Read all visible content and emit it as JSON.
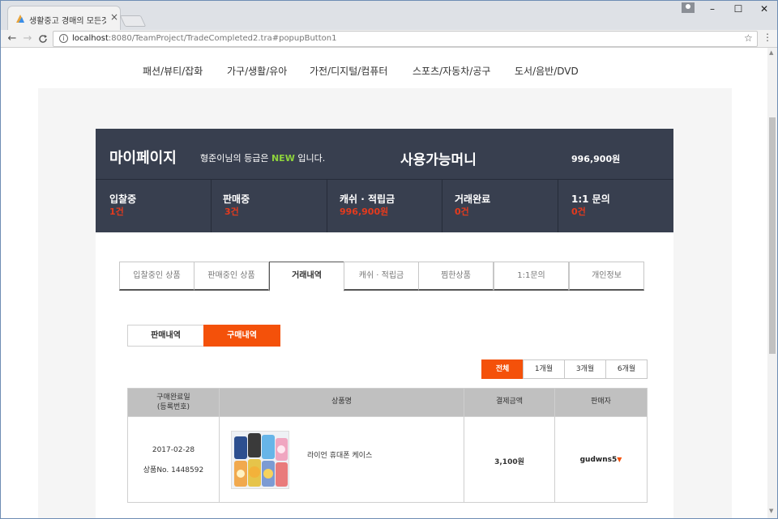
{
  "browser": {
    "tab_title": "생활중고 경매의 모든것",
    "tab_close": "×",
    "url_host": "localhost",
    "url_rest": ":8080/TeamProject/TradeCompleted2.tra#popupButton1",
    "window_controls": [
      "–",
      "☐",
      "✕"
    ],
    "nav_icons": {
      "back": "←",
      "forward": "→",
      "reload": "C"
    }
  },
  "categories": [
    "패션/뷰티/잡화",
    "가구/생활/유아",
    "가전/디지털/컴퓨터",
    "스포츠/자동차/공구",
    "도서/음반/DVD"
  ],
  "mypage": {
    "title": "마이페이지",
    "grade_prefix": "형준이님의 등급은",
    "grade_badge": "NEW",
    "grade_suffix": "입니다.",
    "money_label": "사용가능머니",
    "money_value": "996,900원",
    "stats": [
      {
        "label": "입찰중",
        "value": "1건"
      },
      {
        "label": "판매중",
        "value": "3건"
      },
      {
        "label": "캐쉬 · 적립금",
        "value": "996,900원"
      },
      {
        "label": "거래완료",
        "value": "0건"
      },
      {
        "label": "1:1 문의",
        "value": "0건"
      }
    ]
  },
  "tabs": [
    "입찰중인 상품",
    "판매중인 상품",
    "거래내역",
    "캐쉬 · 적립금",
    "찜한상품",
    "1:1문의",
    "개인정보"
  ],
  "active_tab": "거래내역",
  "segment": {
    "sell": "판매내역",
    "buy": "구매내역",
    "active": "buy"
  },
  "periods": [
    "전체",
    "1개월",
    "3개월",
    "6개월"
  ],
  "active_period": "전체",
  "table": {
    "headers": {
      "date_line1": "구매완료일",
      "date_line2": "(등록번호)",
      "product": "상품명",
      "amount": "결제금액",
      "seller": "판매자"
    },
    "rows": [
      {
        "date": "2017-02-28",
        "reg_no": "상품No. 1448592",
        "product": "라이언 휴대폰 케이스",
        "amount": "3,100원",
        "seller": "gudwns5"
      }
    ]
  },
  "colors": {
    "accent": "#f4510a",
    "banner": "#383f4f",
    "alert": "#e53a1d",
    "badge": "#8ed33c"
  }
}
